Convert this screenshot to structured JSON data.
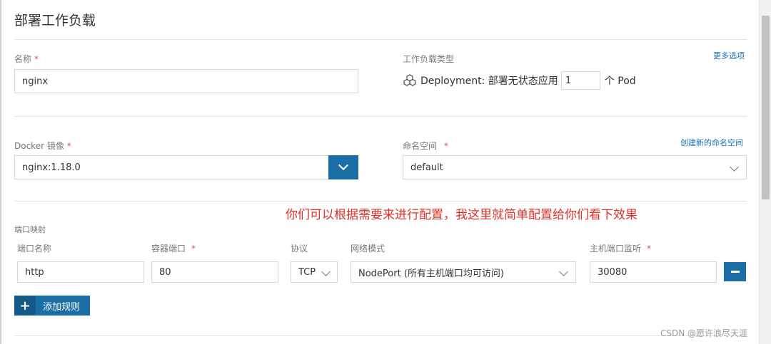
{
  "page": {
    "title": "部署工作负载",
    "more_options": "更多选项"
  },
  "name_field": {
    "label": "名称",
    "required_mark": "*",
    "value": "nginx"
  },
  "workload_type": {
    "label": "工作负载类型",
    "icon": "cubes-icon",
    "text": "Deployment: 部署无状态应用",
    "count": "1",
    "unit": "个 Pod"
  },
  "docker_image": {
    "label": "Docker 镜像",
    "required_mark": "*",
    "value": "nginx:1.18.0",
    "dropdown_icon": "chevron-down-icon"
  },
  "namespace": {
    "label": "命名空间",
    "required_mark": "*",
    "value": "default",
    "create_link": "创建新的命名空间"
  },
  "annotation": "你们可以根据需要来进行配置，我这里就简单配置给你们看下效果",
  "port_mapping": {
    "section_label": "端口映射",
    "headers": {
      "port_name": "端口名称",
      "container_port": "容器端口",
      "protocol": "协议",
      "network_mode": "网络模式",
      "host_port": "主机端口监听"
    },
    "required_mark": "*",
    "row": {
      "port_name": "http",
      "container_port": "80",
      "protocol": "TCP",
      "network_mode": "NodePort (所有主机端口均可访问)",
      "host_port": "30080"
    },
    "add_rule": "添加规则"
  },
  "watermark": "CSDN @愿许浪尽天涯",
  "colors": {
    "primary": "#1b6ea5",
    "required": "#d9534f",
    "annotation": "#e0302a",
    "link": "#1a6fb5"
  }
}
